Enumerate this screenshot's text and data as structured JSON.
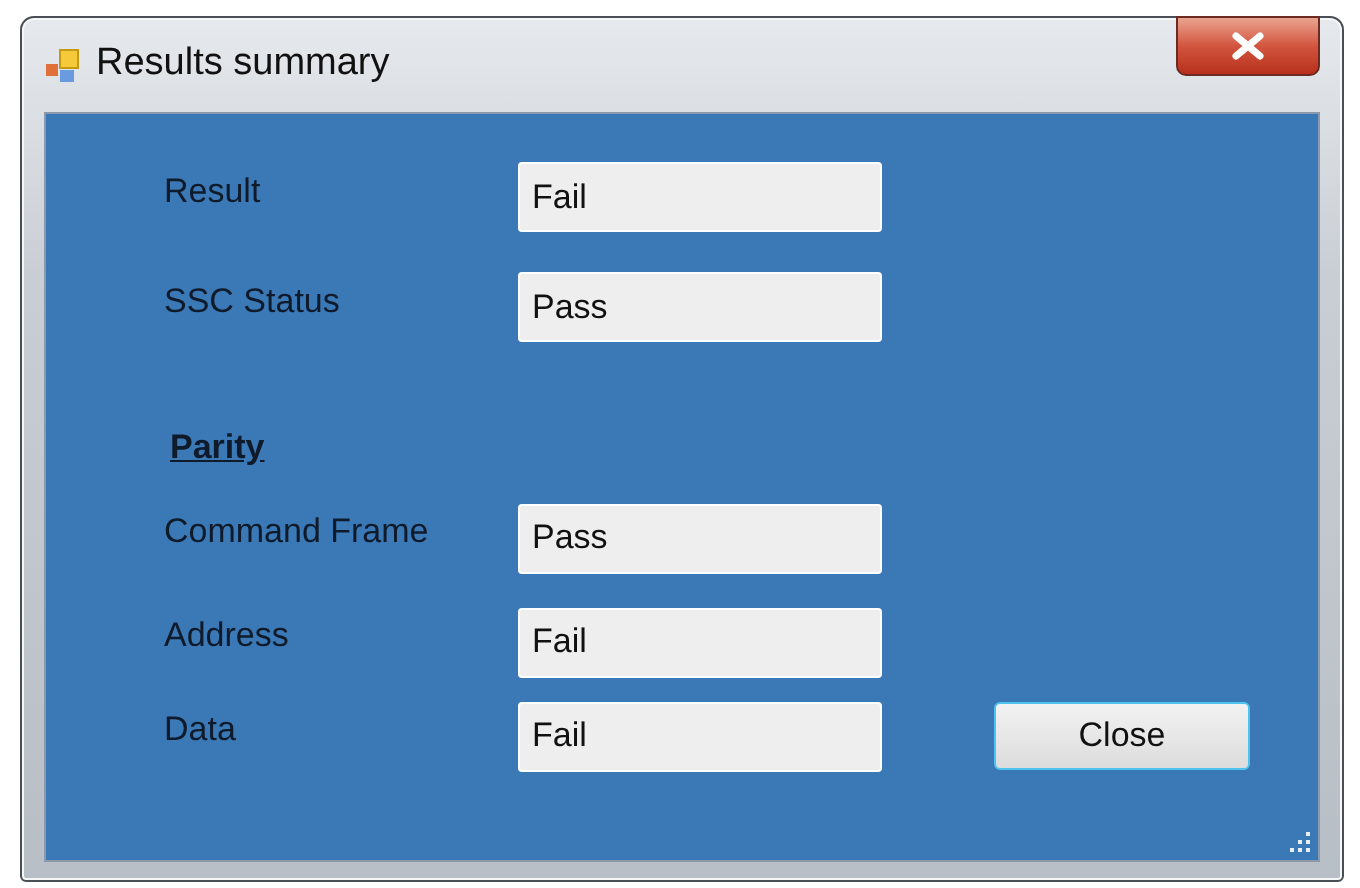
{
  "window": {
    "title": "Results summary"
  },
  "fields": [
    {
      "label": "Result",
      "value": "Fail"
    },
    {
      "label": "SSC Status",
      "value": "Pass"
    }
  ],
  "parity": {
    "heading": "Parity",
    "fields": [
      {
        "label": "Command Frame",
        "value": "Pass"
      },
      {
        "label": "Address",
        "value": "Fail"
      },
      {
        "label": "Data",
        "value": "Fail"
      }
    ]
  },
  "buttons": [
    "Close"
  ]
}
